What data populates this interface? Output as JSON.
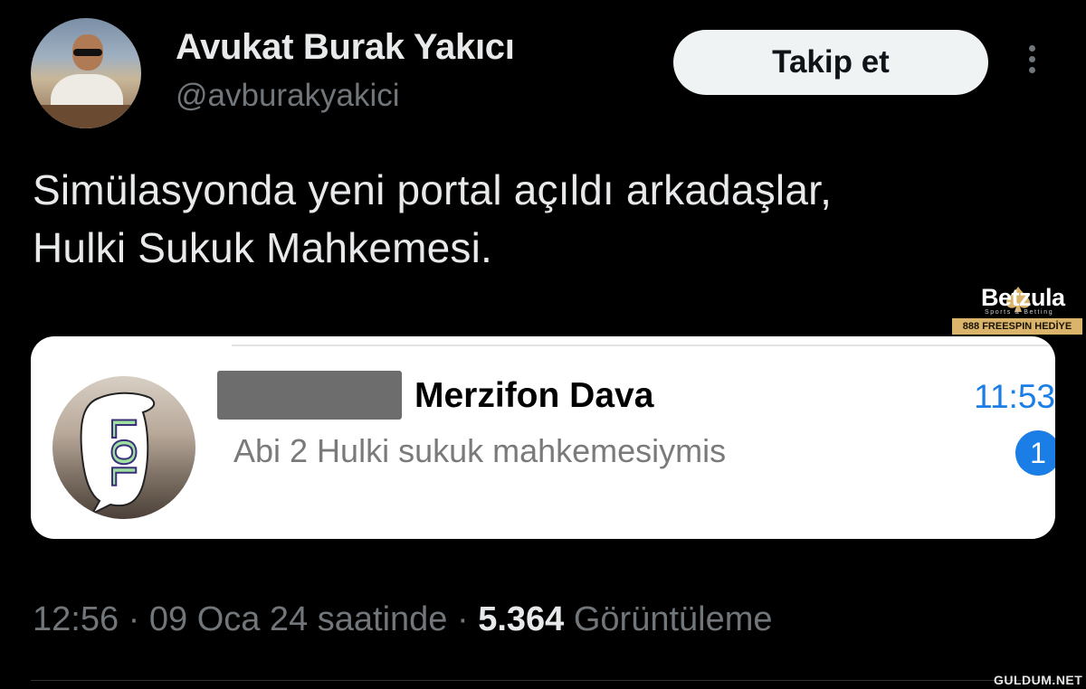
{
  "tweet": {
    "author_name": "Avukat Burak Yakıcı",
    "author_handle": "@avburakyakici",
    "follow_label": "Takip et",
    "text_line1": "Simülasyonda yeni portal açıldı arkadaşlar,",
    "text_line2": "Hulki Sukuk Mahkemesi.",
    "time_date": "12:56 · 09 Oca 24 saatinde · ",
    "views_count": "5.364",
    "views_label": " Görüntüleme"
  },
  "embedded_chat": {
    "chat_title": "Merzifon Dava",
    "time": "11:53",
    "message_preview": "Abi 2 Hulki sukuk mahkemesiymis",
    "unread_count": "1",
    "avatar_text": "LOL"
  },
  "ad": {
    "brand": "Betzula",
    "tagline": "Sports & Betting",
    "promo": "888 FREESPIN HEDİYE"
  },
  "watermark": "GULDUM.NET",
  "colors": {
    "background": "#000000",
    "text_primary": "#e7e9ea",
    "text_secondary": "#71767b",
    "follow_button_bg": "#eff3f4",
    "ios_blue": "#1b7ee6",
    "ad_gold": "#d9b46a"
  },
  "icons": {
    "more": "vertical-ellipsis-icon",
    "ad_logo": "spade-icon"
  }
}
